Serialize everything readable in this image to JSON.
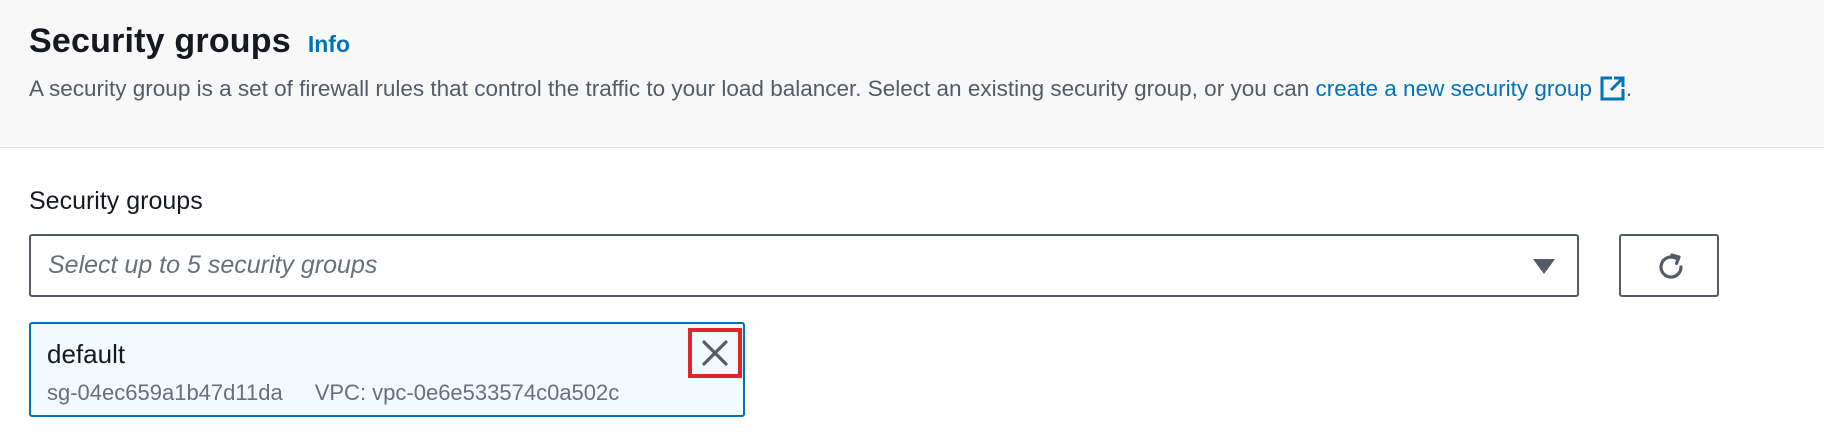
{
  "header": {
    "title": "Security groups",
    "info_link": "Info",
    "description_prefix": "A security group is a set of firewall rules that control the traffic to your load balancer. Select an existing security group, or you can ",
    "description_link": "create a new security group",
    "description_suffix": "."
  },
  "field": {
    "label": "Security groups",
    "placeholder": "Select up to 5 security groups"
  },
  "selected_groups": [
    {
      "name": "default",
      "id": "sg-04ec659a1b47d11da",
      "vpc": "VPC: vpc-0e6e533574c0a502c"
    }
  ],
  "icons": {
    "external_link": "external-link-icon",
    "caret": "caret-down-icon",
    "refresh": "refresh-icon",
    "dismiss": "close-icon"
  },
  "colors": {
    "link": "#0073bb",
    "token_bg": "#f1faff",
    "token_border": "#0073bb",
    "highlight": "#e0262b"
  }
}
